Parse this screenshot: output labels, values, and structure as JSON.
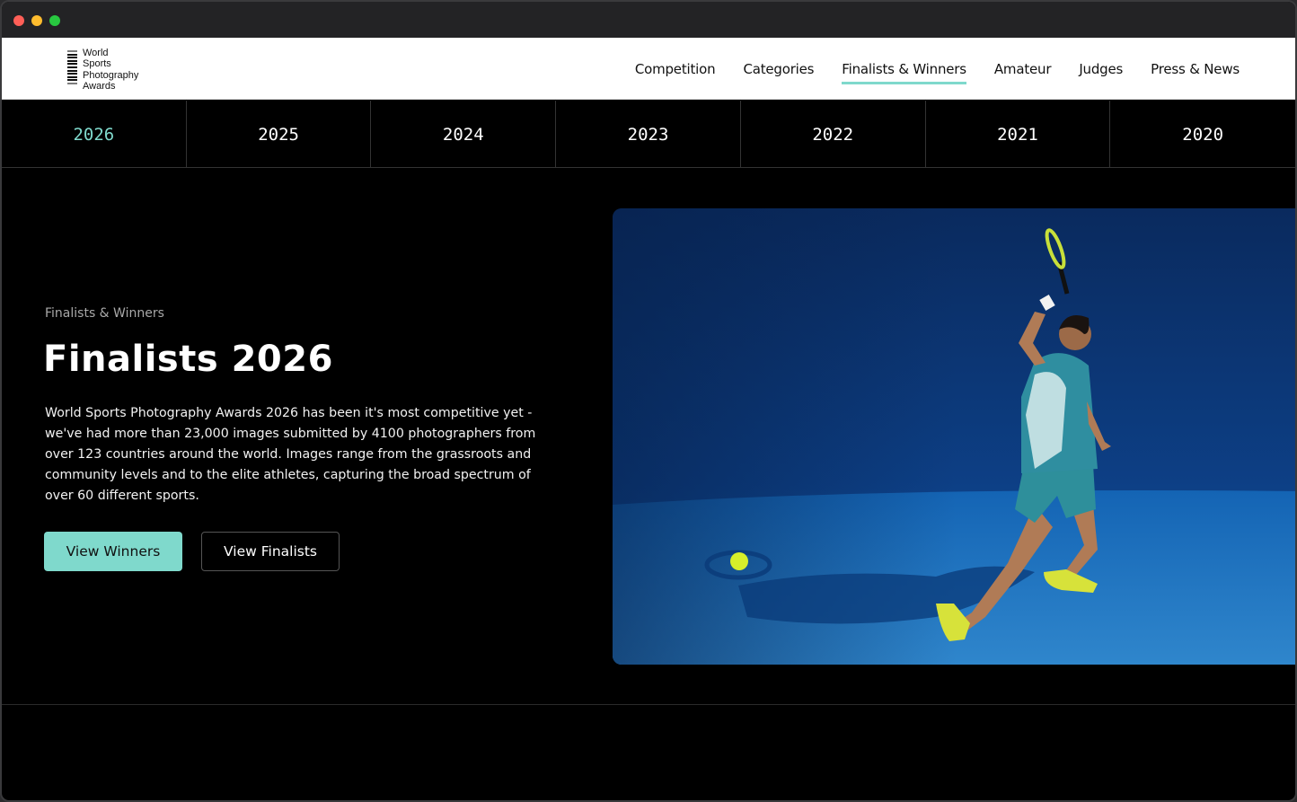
{
  "logo": {
    "lines": [
      "World",
      "Sports",
      "Photography",
      "Awards"
    ]
  },
  "nav": {
    "items": [
      {
        "label": "Competition"
      },
      {
        "label": "Categories"
      },
      {
        "label": "Finalists & Winners",
        "active": true
      },
      {
        "label": "Amateur"
      },
      {
        "label": "Judges"
      },
      {
        "label": "Press & News"
      }
    ]
  },
  "years": [
    "2026",
    "2025",
    "2024",
    "2023",
    "2022",
    "2021",
    "2020"
  ],
  "hero": {
    "eyebrow": "Finalists & Winners",
    "title": "Finalists 2026",
    "body": "World Sports Photography Awards 2026 has been it's most competitive yet - we've had more than 23,000 images submitted by 4100 photographers from over 123 countries around the world. Images range from the grassroots and community levels and to the elite athletes, capturing the broad spectrum of over 60 different sports.",
    "primary_button": "View Winners",
    "secondary_button": "View Finalists"
  },
  "colors": {
    "accent": "#7fd9cc",
    "background": "#000000",
    "court": "#1f6fb8"
  }
}
